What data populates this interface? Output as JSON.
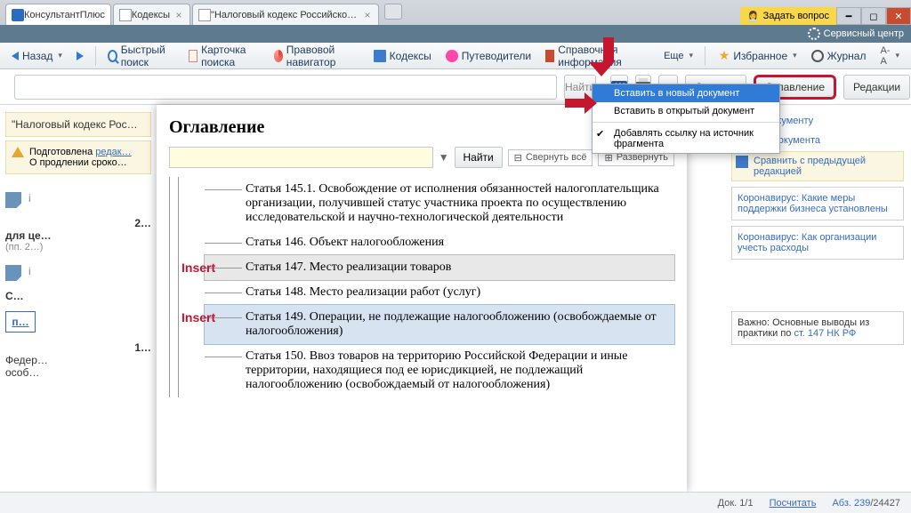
{
  "tabs": {
    "home": "КонсультантПлюс",
    "t1": "Кодексы",
    "t2": "\"Налоговый кодекс Российской Фе…"
  },
  "ask": "Задать вопрос",
  "service": "Сервисный центр",
  "toolbar": {
    "back": "Назад",
    "quick": "Быстрый поиск",
    "card": "Карточка поиска",
    "nav": "Правовой навигатор",
    "codex": "Кодексы",
    "guides": "Путеводители",
    "info": "Справочная информация",
    "more": "Еще",
    "fav": "Избранное",
    "journal": "Журнал",
    "font": "А-А"
  },
  "searchrow": {
    "find": "Найти",
    "help": "Справка",
    "toc": "Оглавление",
    "editions": "Редакции"
  },
  "wmenu": {
    "i1": "Вставить в новый документ",
    "i2": "Вставить в открытый документ",
    "i3": "Добавлять ссылку на источник фрагмента"
  },
  "left": {
    "title": "\"Налоговый кодекс Рос…",
    "prep": "Подготовлена",
    "redak": "редак…",
    "prolong": "О продлении сроко…",
    "art2": "2…",
    "art2txt": "для це…",
    "art2note": "(пп. 2…)",
    "artC": "С…",
    "pill": "п…",
    "art1": "1…",
    "fed": "Федер…",
    "osob": "особ…"
  },
  "toc": {
    "title": "Оглавление",
    "find": "Найти",
    "collapse": "Свернуть всё",
    "expand": "Развернуть",
    "insert": "Insert",
    "items": {
      "i1": "Статья 145.1. Освобождение от исполнения обязанностей налогоплательщика организации, получившей статус участника проекта по осуществлению исследовательской и научно-технологической деятельности",
      "i2": "Статья 146. Объект налогообложения",
      "i3": "Статья 147. Место реализации товаров",
      "i4": "Статья 148. Место реализации работ (услуг)",
      "i5": "Статья 149. Операции, не подлежащие налогообложению (освобождаемые от налогообложения)",
      "i6": "Статья 150. Ввоз товаров на территорию Российской Федерации и иные территории, находящиеся под ее юрисдикцией, не подлежащий налогообложению (освобождаемый от налогообложения)"
    }
  },
  "right": {
    "l1": "…к документу",
    "l2": "…ий документа",
    "l3": "Сравнить с предыдущей редакцией",
    "b1": "Коронавирус: Какие меры поддержки бизнеса установлены",
    "b2": "Коронавирус: Как организации учесть расходы",
    "b3a": "Важно: Основные выводы из практики по ",
    "b3b": "ст. 147 НК РФ"
  },
  "status": {
    "doc": "Док. 1/1",
    "calc": "Посчитать",
    "abz": "Абз. 239",
    "abztotal": "/24427"
  }
}
